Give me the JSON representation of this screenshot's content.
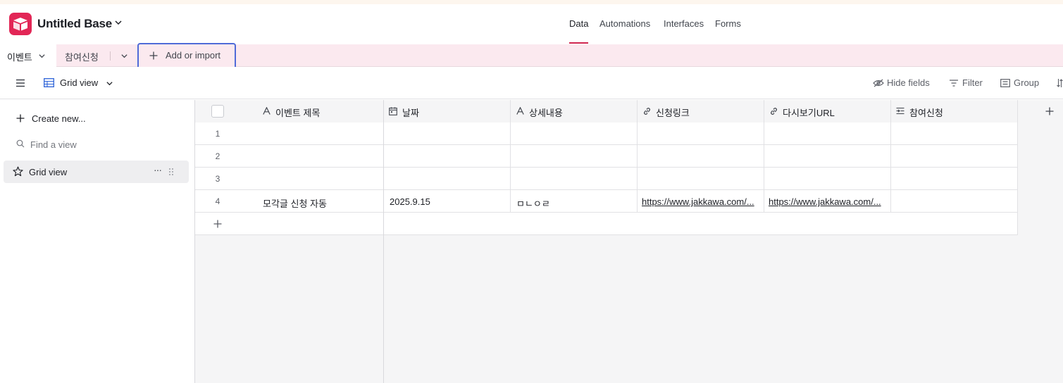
{
  "app": {
    "base_title": "Untitled Base",
    "nav": [
      {
        "label": "Data"
      },
      {
        "label": "Automations"
      },
      {
        "label": "Interfaces"
      },
      {
        "label": "Forms"
      }
    ],
    "accent_color": "#d0254f",
    "logo_color": "#e22656"
  },
  "tables": {
    "items": [
      {
        "label": "이벤트"
      },
      {
        "label": "참여신청"
      }
    ],
    "add_label": "Add or import"
  },
  "viewbar": {
    "view_name": "Grid view",
    "hide_fields": "Hide fields",
    "filter": "Filter",
    "group": "Group"
  },
  "sidebar": {
    "create_new": "Create new...",
    "find_placeholder": "Find a view",
    "views": [
      {
        "label": "Grid view"
      }
    ]
  },
  "grid": {
    "columns": [
      {
        "label": "이벤트 제목",
        "icon": "text-icon"
      },
      {
        "label": "날짜",
        "icon": "calendar-icon"
      },
      {
        "label": "상세내용",
        "icon": "text-icon"
      },
      {
        "label": "신청링크",
        "icon": "link-icon"
      },
      {
        "label": "다시보기URL",
        "icon": "link-icon"
      },
      {
        "label": "참여신청",
        "icon": "linked-record-icon"
      }
    ],
    "rows": [
      {
        "num": "1",
        "cells": [
          "",
          "",
          "",
          "",
          "",
          ""
        ]
      },
      {
        "num": "2",
        "cells": [
          "",
          "",
          "",
          "",
          "",
          ""
        ]
      },
      {
        "num": "3",
        "cells": [
          "",
          "",
          "",
          "",
          "",
          ""
        ]
      },
      {
        "num": "4",
        "cells": [
          "모각글 신청 자동",
          "2025.9.15",
          "ㅁㄴㅇㄹ",
          "https://www.jakkawa.com/...",
          "https://www.jakkawa.com/...",
          ""
        ]
      }
    ]
  }
}
